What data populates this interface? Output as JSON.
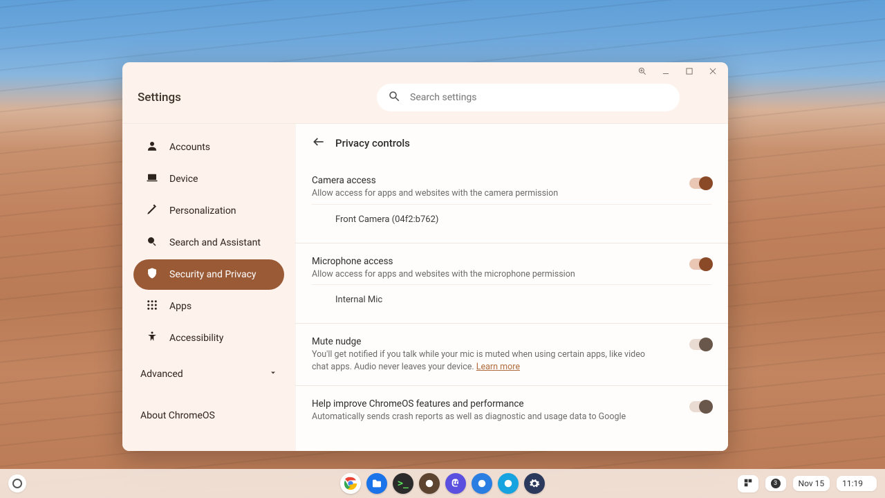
{
  "window": {
    "magnify_icon": "zoom-icon",
    "min_icon": "minimize-icon",
    "max_icon": "maximize-icon",
    "close_icon": "close-icon"
  },
  "header": {
    "title": "Settings",
    "search_placeholder": "Search settings"
  },
  "sidebar": {
    "items": [
      {
        "id": "accounts",
        "label": "Accounts",
        "icon": "person-icon",
        "active": false
      },
      {
        "id": "device",
        "label": "Device",
        "icon": "laptop-icon",
        "active": false
      },
      {
        "id": "personalization",
        "label": "Personalization",
        "icon": "pencil-icon",
        "active": false
      },
      {
        "id": "search-assistant",
        "label": "Search and Assistant",
        "icon": "search-icon",
        "active": false
      },
      {
        "id": "security-privacy",
        "label": "Security and Privacy",
        "icon": "shield-icon",
        "active": true
      },
      {
        "id": "apps",
        "label": "Apps",
        "icon": "apps-icon",
        "active": false
      },
      {
        "id": "accessibility",
        "label": "Accessibility",
        "icon": "accessibility-icon",
        "active": false
      }
    ],
    "advanced_label": "Advanced",
    "about_label": "About ChromeOS"
  },
  "page": {
    "title": "Privacy controls",
    "camera": {
      "title": "Camera access",
      "desc": "Allow access for apps and websites with the camera permission",
      "device_label": "Front Camera (04f2:b762)",
      "on": true
    },
    "mic": {
      "title": "Microphone access",
      "desc": "Allow access for apps and websites with the microphone permission",
      "device_label": "Internal Mic",
      "on": true
    },
    "mute_nudge": {
      "title": "Mute nudge",
      "desc_a": "You'll get notified if you talk while your mic is muted when using certain apps, like video chat apps. Audio never leaves your device. ",
      "learn_more": "Learn more",
      "on": false
    },
    "telemetry": {
      "title": "Help improve ChromeOS features and performance",
      "desc": "Automatically sends crash reports as well as diagnostic and usage data to Google",
      "on": false
    }
  },
  "shelf": {
    "apps": [
      {
        "id": "chrome",
        "label": "Chrome",
        "bg": "#ffffff",
        "icon": "chrome-icon"
      },
      {
        "id": "files",
        "label": "Files",
        "bg": "#1a73e8",
        "icon": "folder-icon"
      },
      {
        "id": "terminal",
        "label": "Terminal",
        "bg": "#2b2b2b",
        "icon": "terminal-icon"
      },
      {
        "id": "app4",
        "label": "App",
        "bg": "#5c4430",
        "icon": "app-icon"
      },
      {
        "id": "mastodon",
        "label": "Mastodon",
        "bg": "#5b4fe0",
        "icon": "mastodon-icon"
      },
      {
        "id": "app6",
        "label": "App",
        "bg": "#2a7de1",
        "icon": "app-icon"
      },
      {
        "id": "app7",
        "label": "App",
        "bg": "#16a3e0",
        "icon": "app-icon"
      },
      {
        "id": "app8",
        "label": "Settings",
        "bg": "#2b3a5c",
        "icon": "gear-icon"
      }
    ],
    "notif_count": "3",
    "date": "Nov 15",
    "time": "11:19",
    "overview_icon": "overview-icon",
    "wifi_icon": "wifi-icon",
    "battery_icon": "battery-icon"
  },
  "colors": {
    "accent": "#9a5a36",
    "toggle_on_track": "#e9c7b4",
    "toggle_on_thumb": "#8b4a27"
  }
}
